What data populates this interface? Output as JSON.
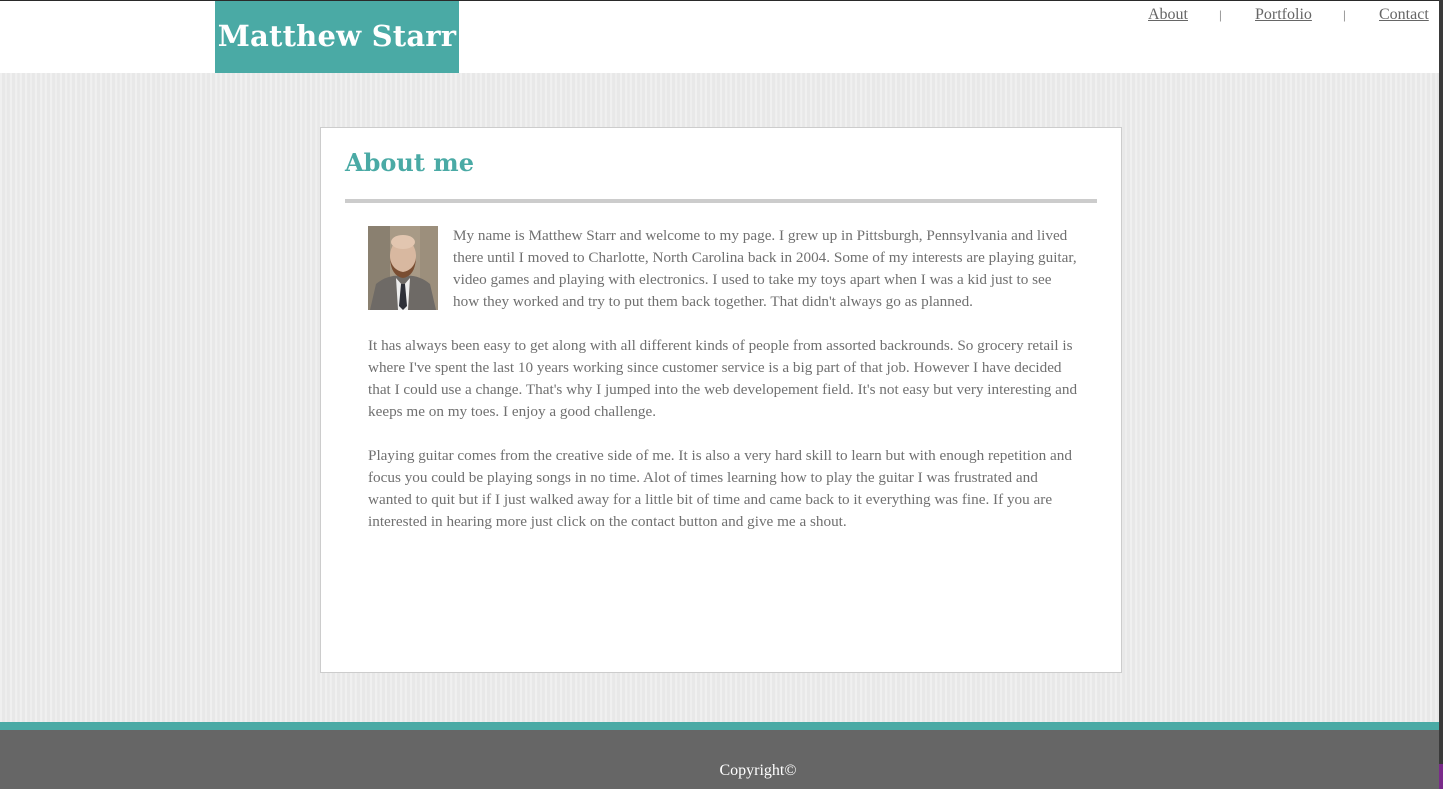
{
  "header": {
    "site_title": "Matthew Starr",
    "nav": {
      "about": "About",
      "separator": "|",
      "portfolio": "Portfolio",
      "contact": "Contact"
    }
  },
  "main": {
    "heading": "About me",
    "paragraphs": [
      "My name is Matthew Starr and welcome to my page. I grew up in Pittsburgh, Pennsylvania and lived there until I moved to Charlotte, North Carolina back in 2004. Some of my interests are playing guitar, video games and playing with electronics. I used to take my toys apart when I was a kid just to see how they worked and try to put them back together. That didn't always go as planned.",
      "It has always been easy to get along with all different kinds of people from assorted backrounds. So grocery retail is where I've spent the last 10 years working since customer service is a big part of that job. However I have decided that I could use a change. That's why I jumped into the web developement field. It's not easy but very interesting and keeps me on my toes. I enjoy a good challenge.",
      "Playing guitar comes from the creative side of me. It is also a very hard skill to learn but with enough repetition and focus you could be playing songs in no time. Alot of times learning how to play the guitar I was frustrated and wanted to quit but if I just walked away for a little bit of time and came back to it everything was fine. If you are interested in hearing more just click on the contact button and give me a shout."
    ]
  },
  "footer": {
    "copyright": "Copyright©"
  },
  "colors": {
    "accent": "#4aaaa5",
    "footer_bg": "#666666",
    "text": "#707070"
  }
}
